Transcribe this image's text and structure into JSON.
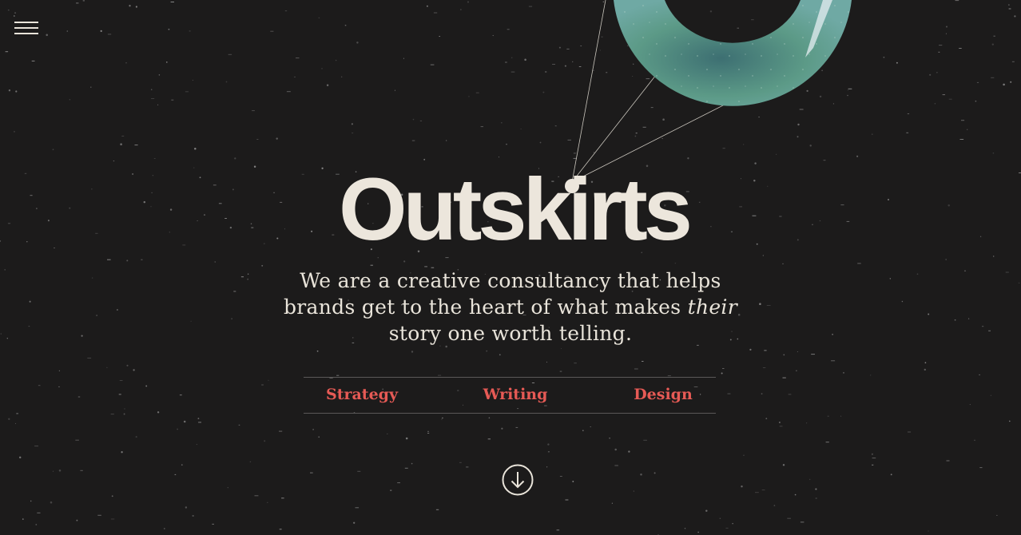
{
  "brand": {
    "name": "Outskirts"
  },
  "tagline": {
    "part1": "We are a creative consultancy that helps brands get to the heart of what makes ",
    "emphasis": "their",
    "part2": " story one worth telling."
  },
  "services": [
    {
      "label": "Strategy"
    },
    {
      "label": "Writing"
    },
    {
      "label": "Design"
    }
  ],
  "colors": {
    "background": "#1c1b1b",
    "text": "#ece6dc",
    "accent": "#e65a55",
    "planet": "#5f9a8a"
  },
  "icons": {
    "menu": "hamburger-menu-icon",
    "scroll": "arrow-down-circle-icon"
  }
}
